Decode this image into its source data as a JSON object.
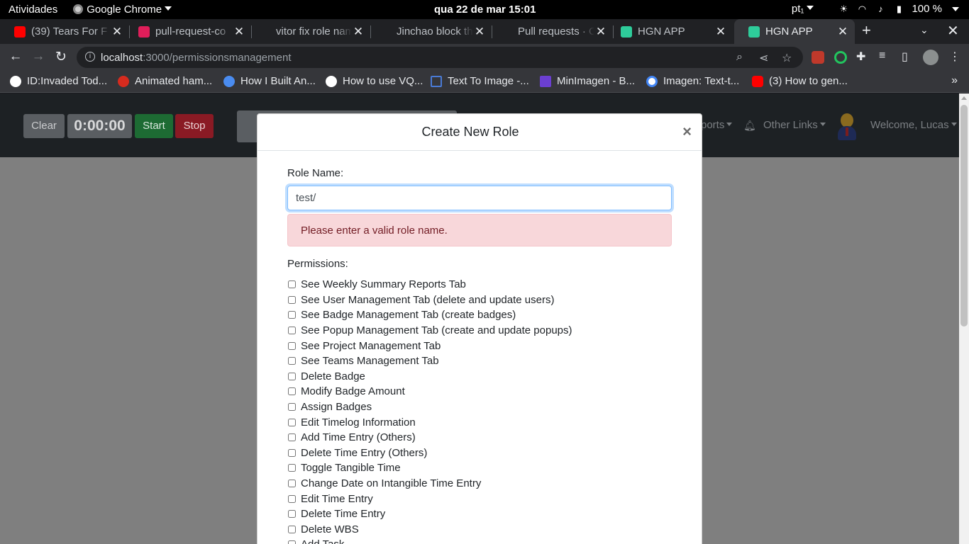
{
  "system_bar": {
    "activities": "Atividades",
    "app_name": "Google Chrome",
    "datetime": "qua 22 de mar  15:01",
    "keyboard": "pt₁",
    "battery": "100 %"
  },
  "tabs": [
    {
      "title": "(39) Tears For F",
      "favicon": "youtube-icon",
      "color": "#ff0000",
      "active": false
    },
    {
      "title": "pull-request-co",
      "favicon": "slack-icon",
      "color": "#e01e5a",
      "active": false
    },
    {
      "title": "vitor fix role nam",
      "favicon": "github-icon",
      "color": "#202124",
      "active": false
    },
    {
      "title": "Jinchao block th",
      "favicon": "check-icon",
      "color": "#202124",
      "active": false
    },
    {
      "title": "Pull requests · O",
      "favicon": "github-icon",
      "color": "#202124",
      "active": false
    },
    {
      "title": "HGN APP",
      "favicon": "hgn-icon",
      "color": "#2ecc9a",
      "active": false
    },
    {
      "title": "HGN APP",
      "favicon": "hgn-icon",
      "color": "#2ecc9a",
      "active": true
    }
  ],
  "address_bar": {
    "host": "localhost",
    "path": ":3000/permissionsmanagement"
  },
  "bookmarks": [
    {
      "label": "ID:Invaded Tod...",
      "icon": "a-logo-icon",
      "color": "#ffffff"
    },
    {
      "label": "Animated ham...",
      "icon": "hamster-icon",
      "color": "#d62b1e"
    },
    {
      "label": "How I Built An...",
      "icon": "gear-icon",
      "color": "#4a8cf0"
    },
    {
      "label": "How to use VQ...",
      "icon": "medium-icon",
      "color": "#ffffff"
    },
    {
      "label": "Text To Image -...",
      "icon": "bracket-icon",
      "color": "#4a7bd6"
    },
    {
      "label": "MinImagen - B...",
      "icon": "assembly-icon",
      "color": "#6b3fd1"
    },
    {
      "label": "Imagen: Text-t...",
      "icon": "google-icon",
      "color": "#4285f4"
    },
    {
      "label": "(3) How to gen...",
      "icon": "youtube-icon",
      "color": "#ff0000"
    }
  ],
  "app_nav": {
    "clear": "Clear",
    "timer": "0:00:00",
    "start": "Start",
    "stop": "Stop",
    "reports": "ports",
    "other_links": "Other Links",
    "welcome": "Welcome, Lucas"
  },
  "modal": {
    "title": "Create New Role",
    "close": "×",
    "role_name_label": "Role Name:",
    "role_name_value": "test/",
    "error": "Please enter a valid role name.",
    "permissions_label": "Permissions:",
    "permissions": [
      "See Weekly Summary Reports Tab",
      "See User Management Tab (delete and update users)",
      "See Badge Management Tab (create badges)",
      "See Popup Management Tab (create and update popups)",
      "See Project Management Tab",
      "See Teams Management Tab",
      "Delete Badge",
      "Modify Badge Amount",
      "Assign Badges",
      "Edit Timelog Information",
      "Add Time Entry (Others)",
      "Delete Time Entry (Others)",
      "Toggle Tangible Time",
      "Change Date on Intangible Time Entry",
      "Edit Time Entry",
      "Delete Time Entry",
      "Delete WBS",
      "Add Task"
    ]
  }
}
